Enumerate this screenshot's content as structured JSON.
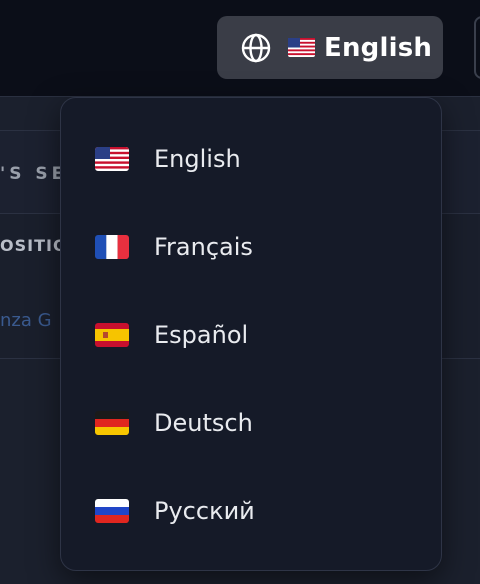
{
  "topbar": {
    "language_button": {
      "icon": "globe-icon",
      "flag": "🇺🇸",
      "label": "English"
    }
  },
  "background": {
    "section_header_fragment": "'S SE",
    "column_header_fragment": "OSITIO",
    "link_fragment": "nza G"
  },
  "language_menu": {
    "items": [
      {
        "code": "en",
        "flag": "us-flag-icon",
        "label": "English"
      },
      {
        "code": "fr",
        "flag": "fr-flag-icon",
        "label": "Français"
      },
      {
        "code": "es",
        "flag": "es-flag-icon",
        "label": "Español"
      },
      {
        "code": "de",
        "flag": "de-flag-icon",
        "label": "Deutsch"
      },
      {
        "code": "ru",
        "flag": "ru-flag-icon",
        "label": "Русский"
      }
    ]
  },
  "colors": {
    "topbar_bg": "#0b0e18",
    "button_bg": "#3a3d47",
    "menu_bg": "#151a28",
    "menu_text": "#e9ebef"
  }
}
